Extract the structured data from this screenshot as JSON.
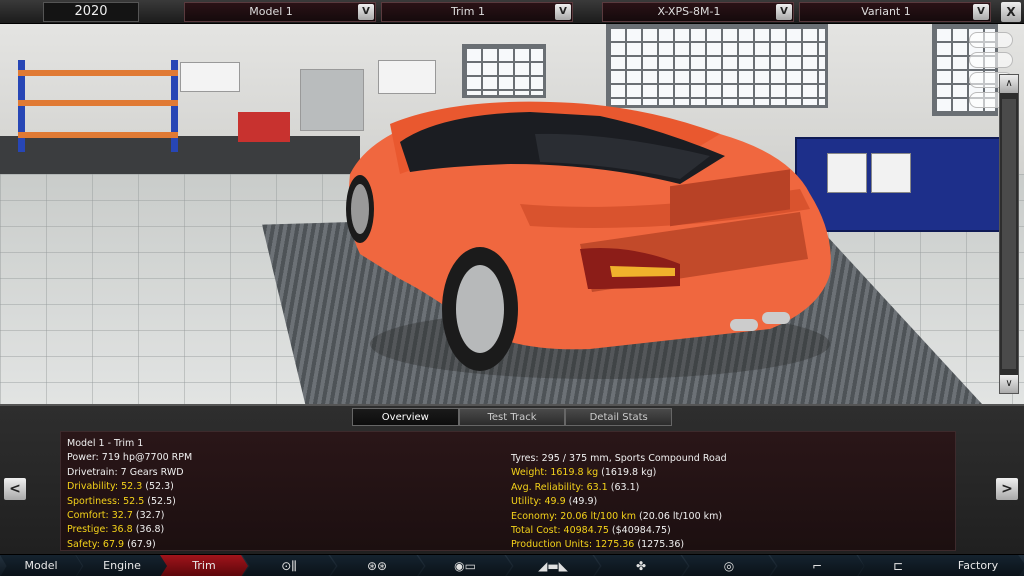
{
  "top_bar": {
    "year": "2020",
    "model": "Model 1",
    "trim": "Trim 1",
    "engine": "X-XPS-8M-1",
    "variant": "Variant 1",
    "dropdown_glyph": "V",
    "close_glyph": "X"
  },
  "scene": {
    "car_color": "#f0673f",
    "scroll_up": "∧",
    "scroll_down": "∨"
  },
  "panel": {
    "tabs": [
      "Overview",
      "Test Track",
      "Detail Stats"
    ],
    "active_tab": "Overview",
    "prev_glyph": "<",
    "next_glyph": ">",
    "left_stats": [
      {
        "text": "Model 1 - Trim 1",
        "label": "",
        "value": "",
        "highlight": false
      },
      {
        "text": "Power: 719 hp@7700 RPM",
        "label": "",
        "value": "",
        "highlight": false
      },
      {
        "text": "Drivetrain: 7 Gears RWD",
        "label": "",
        "value": "",
        "highlight": false
      },
      {
        "text": "",
        "label": "Drivability: 52.3",
        "value": "(52.3)",
        "highlight": true
      },
      {
        "text": "",
        "label": "Sportiness: 52.5",
        "value": "(52.5)",
        "highlight": true
      },
      {
        "text": "",
        "label": "Comfort: 32.7",
        "value": "(32.7)",
        "highlight": true
      },
      {
        "text": "",
        "label": "Prestige: 36.8",
        "value": "(36.8)",
        "highlight": true
      },
      {
        "text": "",
        "label": "Safety: 67.9",
        "value": "(67.9)",
        "highlight": true
      }
    ],
    "right_stats": [
      {
        "text": "Tyres: 295 / 375 mm, Sports Compound Road",
        "label": "",
        "value": "",
        "highlight": false
      },
      {
        "text": "",
        "label": "Weight: 1619.8 kg",
        "value": "(1619.8 kg)",
        "highlight": true
      },
      {
        "text": "",
        "label": "Avg. Reliability: 63.1",
        "value": "(63.1)",
        "highlight": true
      },
      {
        "text": "",
        "label": "Utility: 49.9",
        "value": "(49.9)",
        "highlight": true
      },
      {
        "text": "",
        "label": "Economy: 20.06 lt/100 km",
        "value": "(20.06 lt/100 km)",
        "highlight": true
      },
      {
        "text": "",
        "label": "Total Cost: 40984.75",
        "value": "($40984.75)",
        "highlight": true
      },
      {
        "text": "",
        "label": "Production Units: 1275.36",
        "value": "(1275.36)",
        "highlight": true
      }
    ],
    "colors": {
      "highlight": "#f4d21a",
      "normal": "#f0f0f0"
    }
  },
  "bottom_nav": {
    "model": "Model",
    "engine": "Engine",
    "trim": "Trim",
    "factory": "Factory",
    "icons": [
      "gearbox-icon",
      "wheels-icon",
      "chassis-icon",
      "car-body-icon",
      "fan-icon",
      "steering-icon",
      "seat-icon",
      "suspension-icon",
      "test-track-icon"
    ],
    "icon_glyphs": [
      "⊙⫼",
      "⊛⊛",
      "◉▭",
      "◢▬◣",
      "✤",
      "◎",
      "⌐",
      "⊏",
      "◌▦"
    ],
    "selected": "Trim"
  }
}
